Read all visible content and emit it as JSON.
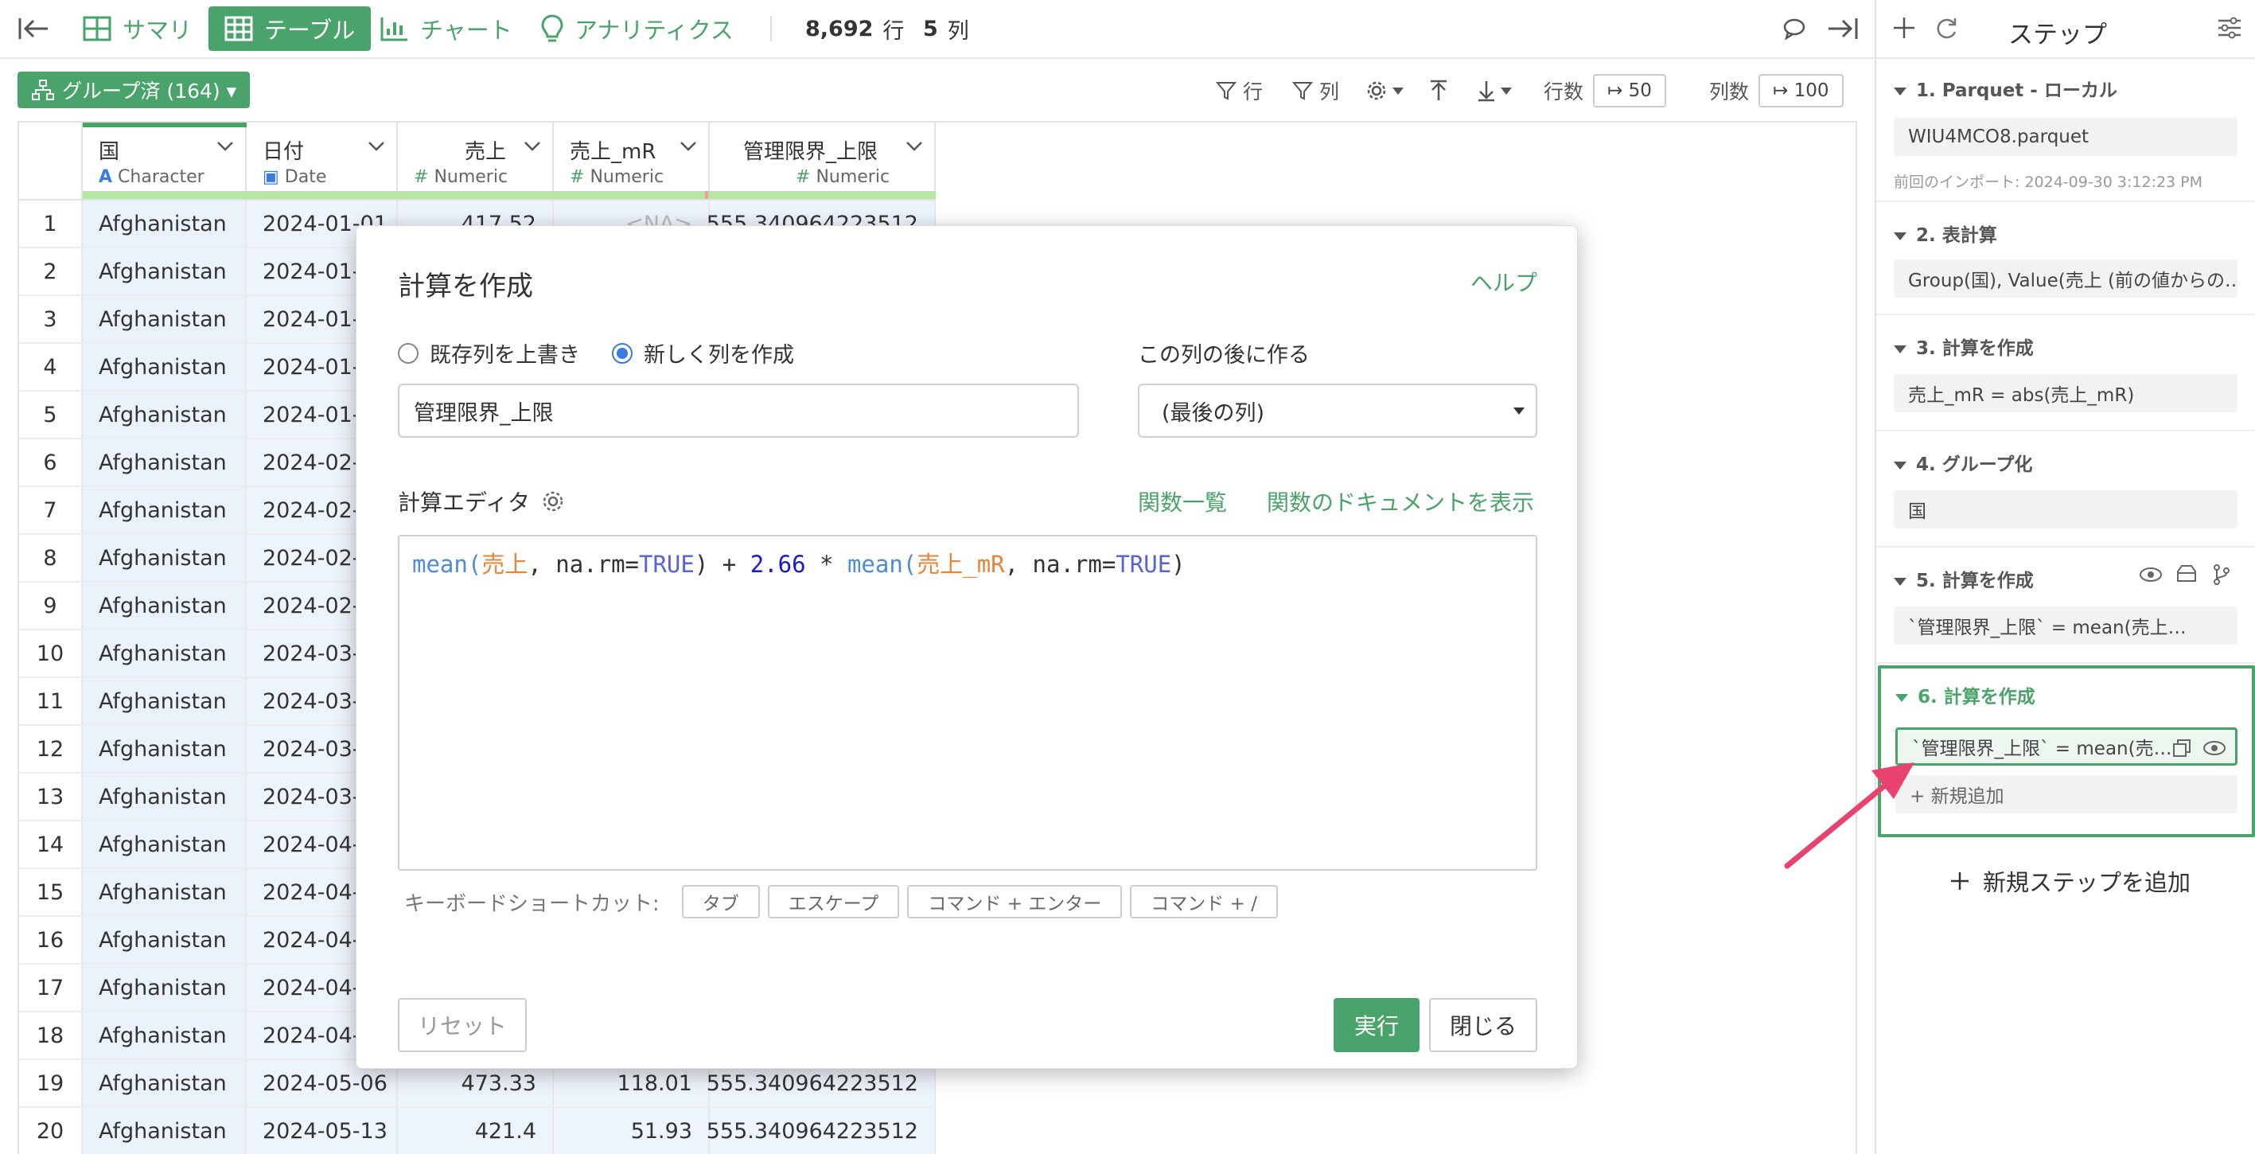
{
  "topbar": {
    "summary": "サマリ",
    "table": "テーブル",
    "chart": "チャート",
    "analytics": "アナリティクス",
    "rows_count": "8,692",
    "rows_unit": "行",
    "cols_count": "5",
    "cols_unit": "列"
  },
  "subbar": {
    "group_label": "グループ済 (164) ▾",
    "row_filter": "行",
    "col_filter": "列",
    "rows_label": "行数",
    "rows_value": "↦ 50",
    "cols_label": "列数",
    "cols_value": "↦ 100"
  },
  "columns": [
    {
      "name": "国",
      "type": "Character"
    },
    {
      "name": "日付",
      "type": "Date"
    },
    {
      "name": "売上",
      "type": "Numeric"
    },
    {
      "name": "売上_mR",
      "type": "Numeric"
    },
    {
      "name": "管理限界_上限",
      "type": "Numeric"
    }
  ],
  "rows": [
    {
      "n": "1",
      "country": "Afghanistan",
      "date": "2024-01-01",
      "sales": "417.52",
      "mr": "<NA>",
      "ucl": "555.340964223512"
    },
    {
      "n": "2",
      "country": "Afghanistan",
      "date": "2024-01-0",
      "sales": "",
      "mr": "",
      "ucl": ""
    },
    {
      "n": "3",
      "country": "Afghanistan",
      "date": "2024-01-",
      "sales": "",
      "mr": "",
      "ucl": ""
    },
    {
      "n": "4",
      "country": "Afghanistan",
      "date": "2024-01-2",
      "sales": "",
      "mr": "",
      "ucl": ""
    },
    {
      "n": "5",
      "country": "Afghanistan",
      "date": "2024-01-2",
      "sales": "",
      "mr": "",
      "ucl": ""
    },
    {
      "n": "6",
      "country": "Afghanistan",
      "date": "2024-02-0",
      "sales": "",
      "mr": "",
      "ucl": ""
    },
    {
      "n": "7",
      "country": "Afghanistan",
      "date": "2024-02-",
      "sales": "",
      "mr": "",
      "ucl": ""
    },
    {
      "n": "8",
      "country": "Afghanistan",
      "date": "2024-02-",
      "sales": "",
      "mr": "",
      "ucl": ""
    },
    {
      "n": "9",
      "country": "Afghanistan",
      "date": "2024-02-2",
      "sales": "",
      "mr": "",
      "ucl": ""
    },
    {
      "n": "10",
      "country": "Afghanistan",
      "date": "2024-03-0",
      "sales": "",
      "mr": "",
      "ucl": ""
    },
    {
      "n": "11",
      "country": "Afghanistan",
      "date": "2024-03-",
      "sales": "",
      "mr": "",
      "ucl": ""
    },
    {
      "n": "12",
      "country": "Afghanistan",
      "date": "2024-03-",
      "sales": "",
      "mr": "",
      "ucl": ""
    },
    {
      "n": "13",
      "country": "Afghanistan",
      "date": "2024-03-2",
      "sales": "",
      "mr": "",
      "ucl": ""
    },
    {
      "n": "14",
      "country": "Afghanistan",
      "date": "2024-04-0",
      "sales": "",
      "mr": "",
      "ucl": ""
    },
    {
      "n": "15",
      "country": "Afghanistan",
      "date": "2024-04-0",
      "sales": "",
      "mr": "",
      "ucl": ""
    },
    {
      "n": "16",
      "country": "Afghanistan",
      "date": "2024-04-",
      "sales": "",
      "mr": "",
      "ucl": ""
    },
    {
      "n": "17",
      "country": "Afghanistan",
      "date": "2024-04-2",
      "sales": "",
      "mr": "",
      "ucl": ""
    },
    {
      "n": "18",
      "country": "Afghanistan",
      "date": "2024-04-2",
      "sales": "",
      "mr": "",
      "ucl": ""
    },
    {
      "n": "19",
      "country": "Afghanistan",
      "date": "2024-05-06",
      "sales": "473.33",
      "mr": "118.01",
      "ucl": "555.340964223512"
    },
    {
      "n": "20",
      "country": "Afghanistan",
      "date": "2024-05-13",
      "sales": "421.4",
      "mr": "51.93",
      "ucl": "555.340964223512"
    }
  ],
  "dialog": {
    "title": "計算を作成",
    "help": "ヘルプ",
    "radio_overwrite": "既存列を上書き",
    "radio_new": "新しく列を作成",
    "after_label": "この列の後に作る",
    "column_name": "管理限界_上限",
    "after_value": "(最後の列)",
    "editor_label": "計算エディタ",
    "fn_list": "関数一覧",
    "fn_doc": "関数のドキュメントを表示",
    "code": {
      "t1": "mean(",
      "t2": "売上",
      "t3": ", na.rm=",
      "t4": "TRUE",
      "t5": ") + ",
      "t6": "2.66",
      "t7": " * ",
      "t8": "mean(",
      "t9": "売上_mR",
      "t10": ", na.rm=",
      "t11": "TRUE",
      "t12": ")"
    },
    "shortcuts_label": "キーボードショートカット:",
    "shortcuts": [
      "タブ",
      "エスケープ",
      "コマンド + エンター",
      "コマンド + /"
    ],
    "reset": "リセット",
    "run": "実行",
    "close": "閉じる"
  },
  "panel": {
    "title": "ステップ",
    "steps": [
      {
        "title": "1. Parquet - ローカル",
        "body": "WIU4MCO8.parquet",
        "note": "前回のインポート: 2024-09-30 3:12:23 PM"
      },
      {
        "title": "2. 表計算",
        "body": "Group(国), Value(売上 (前の値からの…"
      },
      {
        "title": "3. 計算を作成",
        "body": "売上_mR = abs(売上_mR)"
      },
      {
        "title": "4. グループ化",
        "body": "国"
      },
      {
        "title": "5. 計算を作成",
        "body": "`管理限界_上限` = mean(売上…"
      },
      {
        "title": "6. 計算を作成",
        "body": "`管理限界_上限` = mean(売…",
        "add": "+ 新規追加"
      }
    ],
    "add_step": "新規ステップを追加"
  },
  "colors": {
    "accent": "#4aa36a",
    "arrow": "#e8436e",
    "country_bg": "#eaf3fb"
  }
}
